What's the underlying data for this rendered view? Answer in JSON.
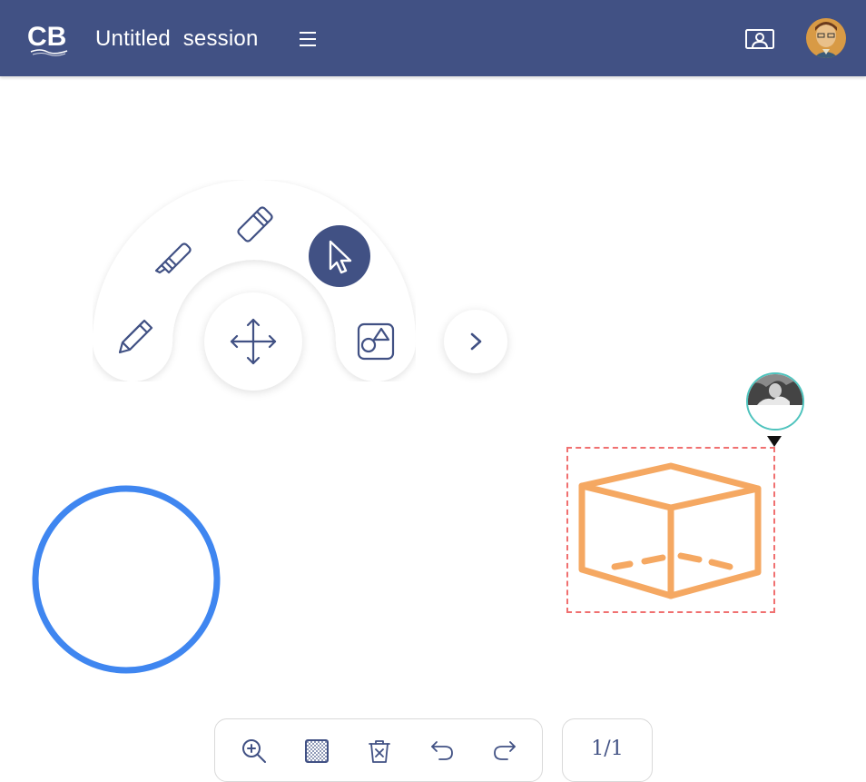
{
  "header": {
    "logo_text": "CB",
    "title": "Untitled  session",
    "background_color": "#415184",
    "menu_icon": "hamburger-menu-icon",
    "present_icon": "presenter-screen-icon",
    "avatar_icon": "user-avatar"
  },
  "tool_menu": {
    "tools": [
      {
        "name": "pencil",
        "icon": "pencil-icon"
      },
      {
        "name": "highlighter",
        "icon": "highlighter-icon"
      },
      {
        "name": "eraser",
        "icon": "eraser-icon"
      },
      {
        "name": "select",
        "icon": "cursor-arrow-icon",
        "active": true
      },
      {
        "name": "shapes",
        "icon": "shapes-icon"
      },
      {
        "name": "move",
        "icon": "move-arrows-icon"
      },
      {
        "name": "next",
        "icon": "chevron-right-icon"
      }
    ],
    "accent_color": "#415184"
  },
  "canvas": {
    "circle_color": "#3f86f0",
    "cube_color": "#f5a862",
    "selection_color": "#f07070",
    "collaborator_ring_color": "#4ec3bd"
  },
  "bottom_toolbar": {
    "buttons": [
      {
        "name": "zoom-in",
        "icon": "zoom-in-icon"
      },
      {
        "name": "background",
        "icon": "background-pattern-icon"
      },
      {
        "name": "clear",
        "icon": "trash-x-icon"
      },
      {
        "name": "undo",
        "icon": "undo-icon"
      },
      {
        "name": "redo",
        "icon": "redo-icon"
      }
    ],
    "page_indicator": "1/1"
  }
}
